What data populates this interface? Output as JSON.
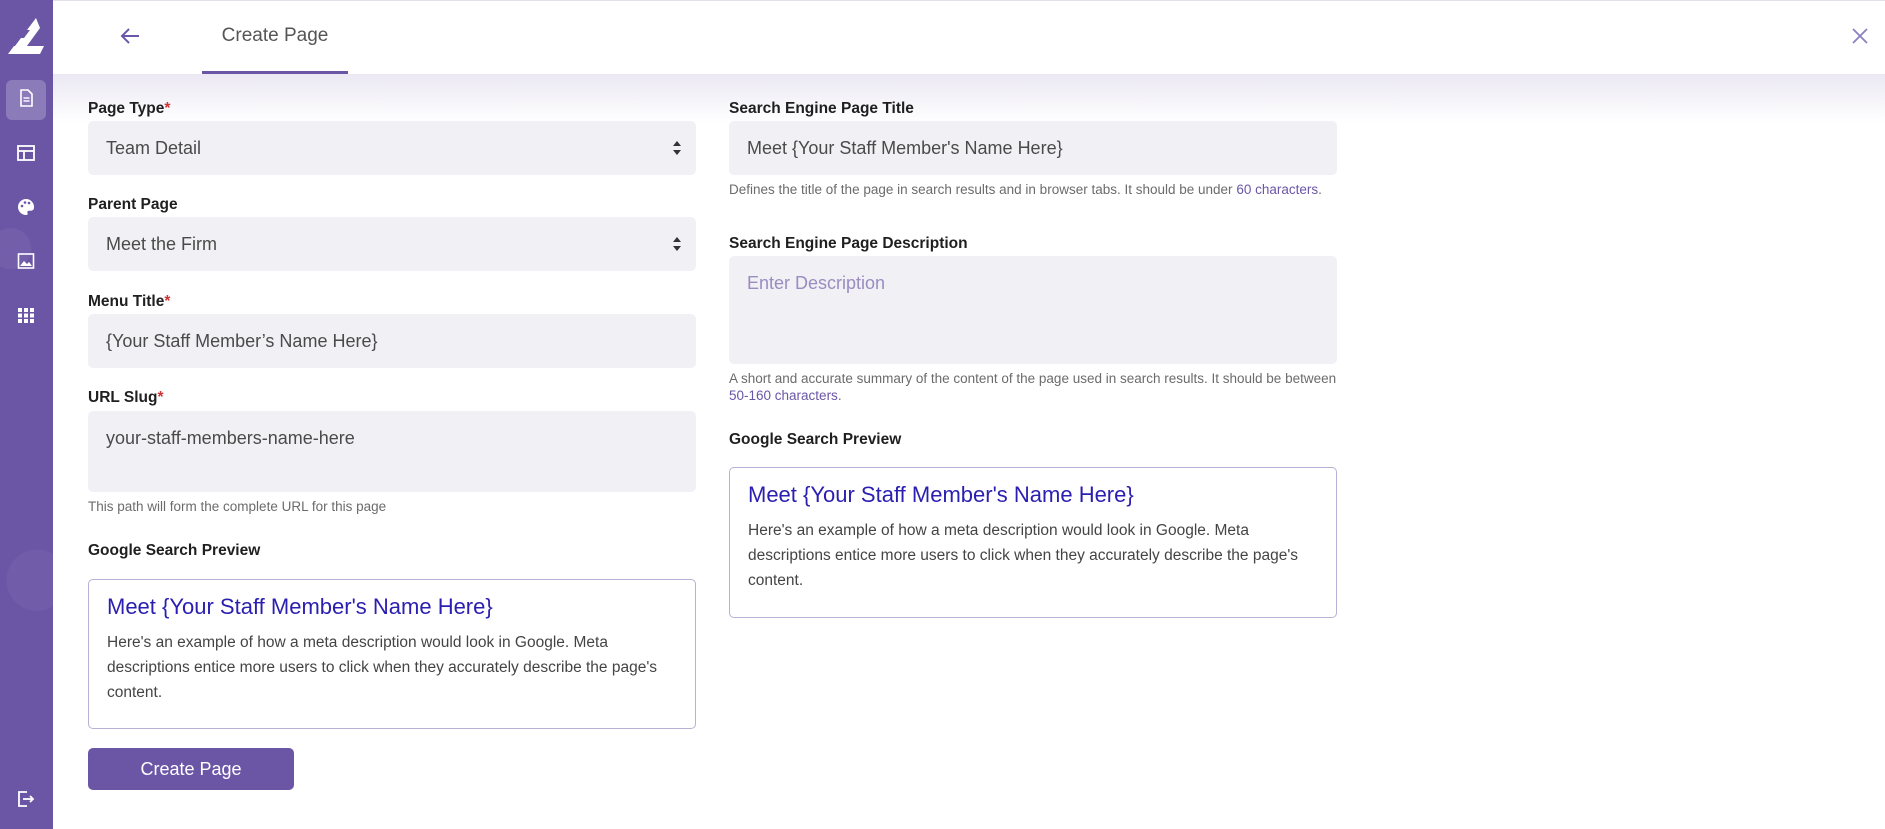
{
  "sidebar": {
    "items": [
      {
        "icon": "document-icon"
      },
      {
        "icon": "layout-icon"
      },
      {
        "icon": "palette-icon"
      },
      {
        "icon": "image-icon"
      },
      {
        "icon": "grid-icon"
      }
    ],
    "logout_icon": "logout-icon"
  },
  "header": {
    "tab_label": "Create Page"
  },
  "left": {
    "page_type": {
      "label": "Page Type",
      "value": "Team Detail"
    },
    "parent_page": {
      "label": "Parent Page",
      "value": "Meet the Firm"
    },
    "menu_title": {
      "label": "Menu Title",
      "value": "{Your Staff Member’s Name Here}"
    },
    "url_slug": {
      "label": "URL Slug",
      "value": "your-staff-members-name-here",
      "hint": "This path will form the complete URL for this page"
    },
    "preview": {
      "label": "Google Search Preview",
      "title": "Meet {Your Staff Member's Name Here}",
      "description": "Here's an example of how a meta description would look in Google. Meta descriptions entice more users to click when they accurately describe the page's content."
    },
    "submit_label": "Create Page"
  },
  "right": {
    "seo_title": {
      "label": "Search Engine Page Title",
      "value": "Meet {Your Staff Member's Name Here}",
      "hint_before": "Defines the title of the page in search results and in browser tabs. It should be under ",
      "hint_link": "60 characters",
      "hint_after": "."
    },
    "seo_description": {
      "label": "Search Engine Page Description",
      "placeholder": "Enter Description",
      "hint_before": "A short and accurate summary of the content of the page used in search results. It should be between ",
      "hint_link": "50-160 characters",
      "hint_after": "."
    },
    "preview": {
      "label": "Google Search Preview",
      "title": "Meet {Your Staff Member's Name Here}",
      "description": "Here's an example of how a meta description would look in Google. Meta descriptions entice more users to click when they accurately describe the page's content."
    }
  },
  "colors": {
    "accent": "#6b56a6",
    "preview_title": "#2a1fb0",
    "required": "#d03535"
  }
}
